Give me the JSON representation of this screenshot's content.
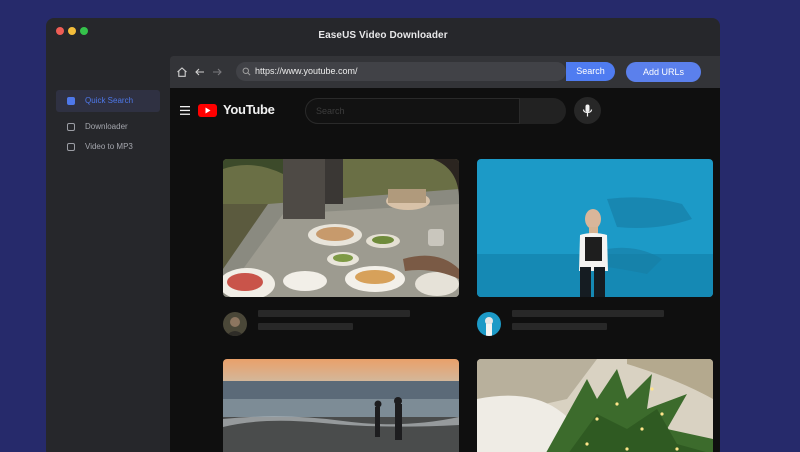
{
  "window": {
    "title": "EaseUS Video Downloader"
  },
  "sidebar": {
    "items": [
      {
        "label": "Quick Search",
        "active": true
      },
      {
        "label": "Downloader",
        "active": false
      },
      {
        "label": "Video to MP3",
        "active": false
      }
    ]
  },
  "browser": {
    "url": "https://www.youtube.com/",
    "search_label": "Search",
    "add_urls_label": "Add URLs"
  },
  "youtube": {
    "brand": "YouTube",
    "search_placeholder": "Search"
  },
  "colors": {
    "background": "#262a6b",
    "accent": "#4f7cf1",
    "youtube_red": "#ff0000"
  }
}
